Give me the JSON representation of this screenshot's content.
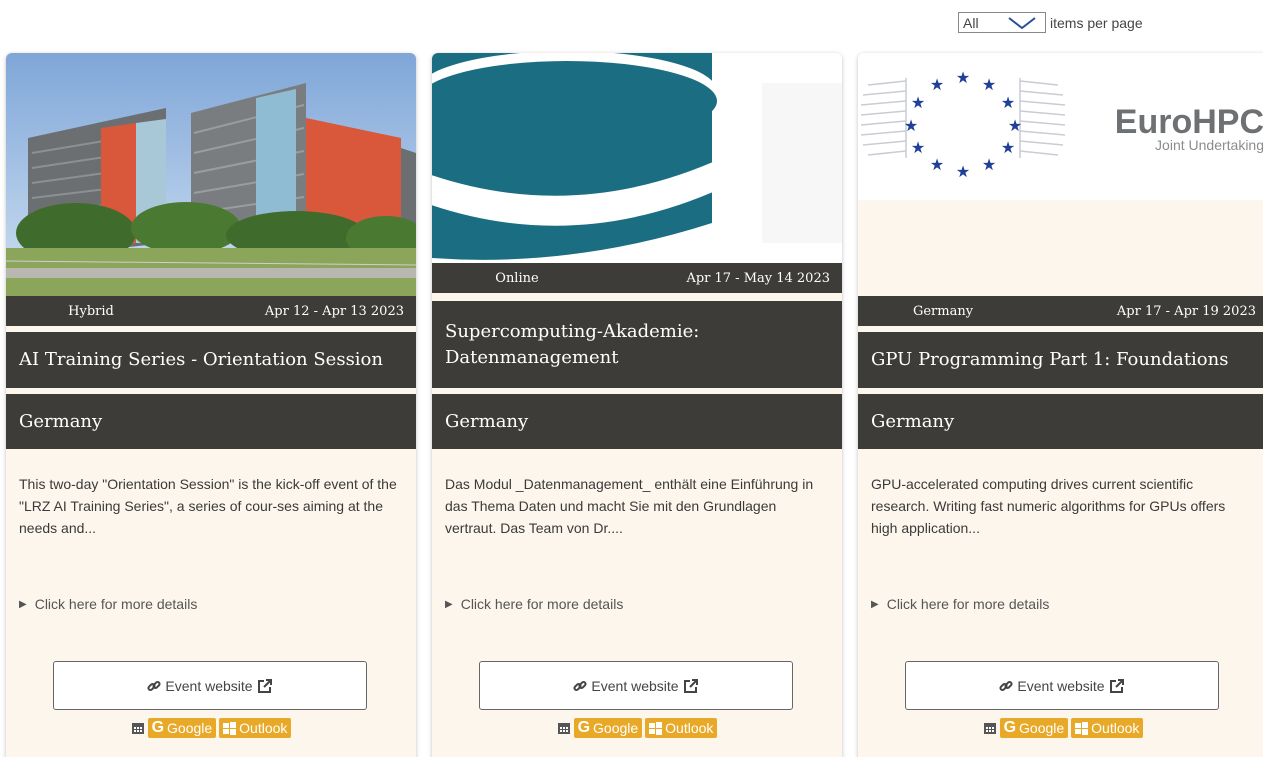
{
  "pagination": {
    "selected": "All",
    "label": "items per page"
  },
  "cards": [
    {
      "mode": "Hybrid",
      "dates": "Apr 12 - Apr 13 2023",
      "title": "AI Training Series - Orientation Session",
      "country": "Germany",
      "description": "This two-day \"Orientation Session\" is the kick-off event of the \"LRZ AI Training Series\", a series of cour-ses aiming at the needs and...",
      "details": "Click here for more details",
      "website": "Event website",
      "google": "Google",
      "outlook": "Outlook"
    },
    {
      "mode": "Online",
      "dates": "Apr 17 - May 14 2023",
      "title": "Supercomputing-Akademie: Datenmanagement",
      "country": "Germany",
      "description": "Das Modul _Datenmanagement_ enthält eine Einführung in das Thema Daten und macht Sie mit den Grundlagen vertraut. Das Team von Dr....",
      "details": "Click here for more details",
      "website": "Event website",
      "google": "Google",
      "outlook": "Outlook"
    },
    {
      "mode": "Germany",
      "dates": "Apr 17 - Apr 19 2023",
      "title": "GPU Programming Part 1: Foundations",
      "country": "Germany",
      "description": "GPU-accelerated computing drives current scientific research. Writing fast numeric algorithms for GPUs offers high application...",
      "details": "Click here for more details",
      "website": "Event website",
      "google": "Google",
      "outlook": "Outlook",
      "logo_text": "EuroHPC",
      "logo_subtext": "Joint Undertaking"
    }
  ],
  "colors": {
    "dark_bar": "#3e3c39",
    "card_bg": "#fdf6ec",
    "calendar_button": "#e8a928",
    "eu_blue": "#1f3f99"
  }
}
